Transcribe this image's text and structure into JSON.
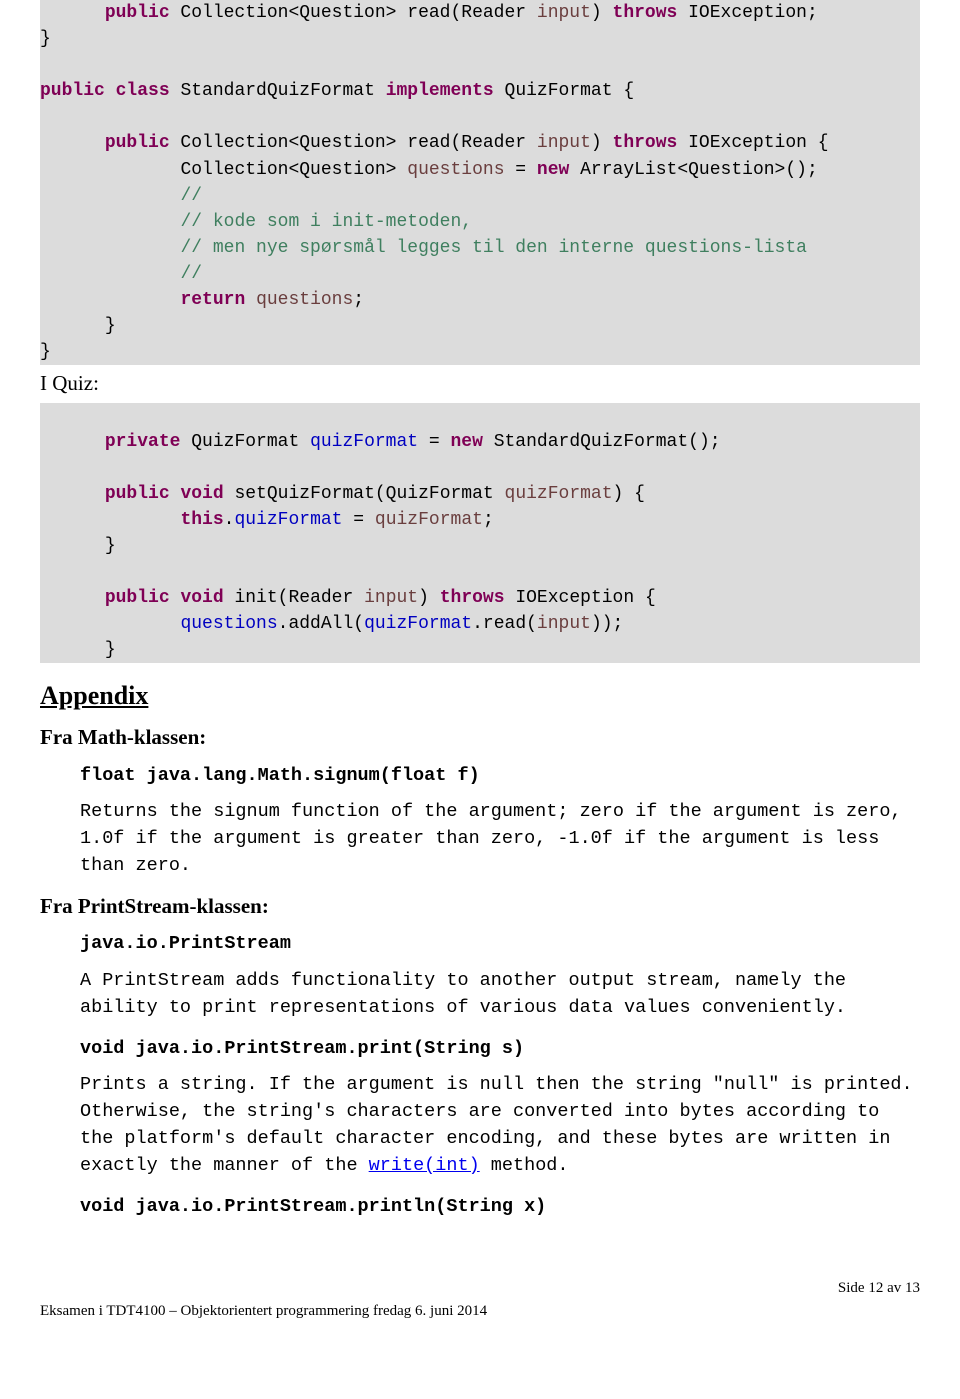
{
  "code": {
    "l1a": "public",
    "l1b": " Collection<Question> read(Reader ",
    "l1c": "input",
    "l1d": ") ",
    "l1e": "throws",
    "l1f": " IOException;",
    "l2": "}",
    "l3a": "public",
    "l3b": " ",
    "l3c": "class",
    "l3d": " StandardQuizFormat ",
    "l3e": "implements",
    "l3f": " QuizFormat {",
    "l4a": "public",
    "l4b": " Collection<Question> read(Reader ",
    "l4c": "input",
    "l4d": ") ",
    "l4e": "throws",
    "l4f": " IOException {",
    "l5a": "Collection<Question> ",
    "l5b": "questions",
    "l5c": " = ",
    "l5d": "new",
    "l5e": " ArrayList<Question>();",
    "l6": "//",
    "l7": "// kode som i init-metoden,",
    "l8": "// men nye spørsmål legges til den interne questions-lista",
    "l9": "//",
    "l10a": "return",
    "l10b": " ",
    "l10c": "questions",
    "l10d": ";",
    "l11": "}",
    "l12": "}",
    "iquiz": "I Quiz:",
    "l13a": "private",
    "l13b": " QuizFormat ",
    "l13c": "quizFormat",
    "l13d": " = ",
    "l13e": "new",
    "l13f": " StandardQuizFormat();",
    "l14a": "public",
    "l14b": " ",
    "l14c": "void",
    "l14d": " setQuizFormat(QuizFormat ",
    "l14e": "quizFormat",
    "l14f": ") {",
    "l15a": "this",
    "l15b": ".",
    "l15c": "quizFormat",
    "l15d": " = ",
    "l15e": "quizFormat",
    "l15f": ";",
    "l16": "}",
    "l17a": "public",
    "l17b": " ",
    "l17c": "void",
    "l17d": " init(Reader ",
    "l17e": "input",
    "l17f": ") ",
    "l17g": "throws",
    "l17h": " IOException {",
    "l18a": "questions",
    "l18b": ".addAll(",
    "l18c": "quizFormat",
    "l18d": ".read(",
    "l18e": "input",
    "l18f": "));",
    "l19": "}"
  },
  "appendix": {
    "heading": "Appendix",
    "math_heading": "Fra Math-klassen:",
    "math_sig": "float java.lang.Math.signum(float f)",
    "math_desc": "Returns the signum function of the argument; zero if the argument is zero, 1.0f if the argument is greater than zero, -1.0f if the argument is less than zero.",
    "ps_heading": "Fra PrintStream-klassen:",
    "ps_sig": "java.io.PrintStream",
    "ps_desc": "A PrintStream adds functionality to another output stream, namely the ability to print representations of various data values conveniently.",
    "print_sig": "void java.io.PrintStream.print(String s)",
    "print_desc_a": "Prints a string. If the argument is null then the string \"null\" is printed. Otherwise, the string's characters are converted into bytes according to the platform's default character encoding, and these bytes are written in exactly the manner of the ",
    "print_link": "write(int)",
    "print_desc_b": " method.",
    "println_sig": "void java.io.PrintStream.println(String x)"
  },
  "footer": {
    "right": "Side 12 av 13",
    "left": "Eksamen i TDT4100 – Objektorientert programmering fredag 6. juni 2014"
  }
}
